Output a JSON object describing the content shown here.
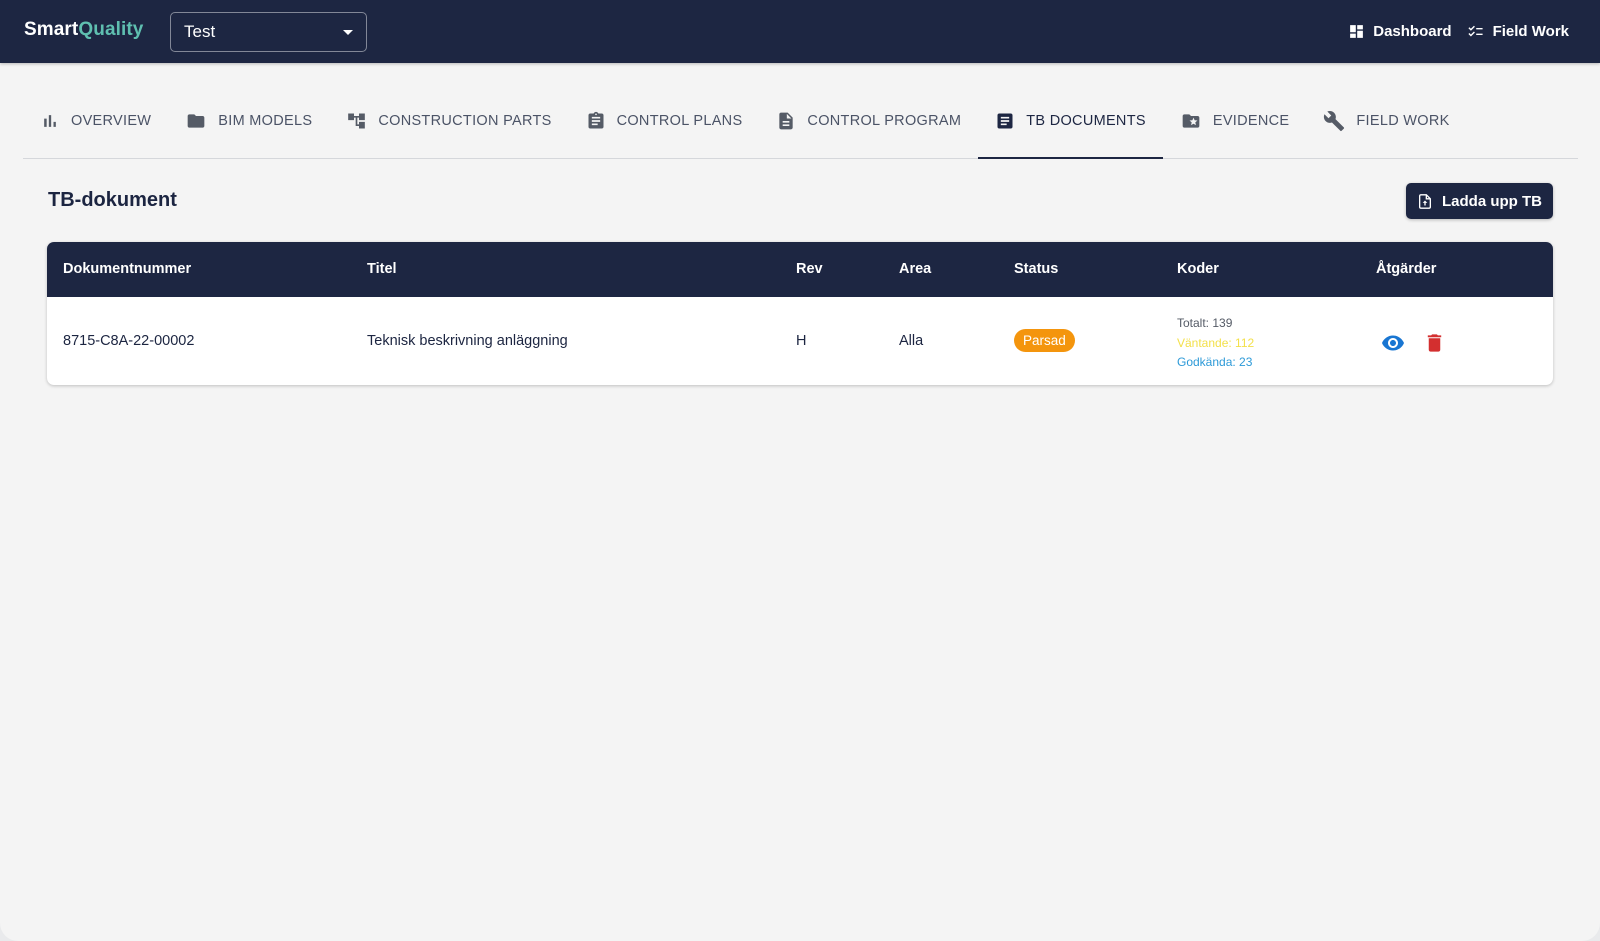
{
  "brand": {
    "part1": "Smart",
    "part2": "Quality",
    "accent_color": "#5fbfb0"
  },
  "project_select": {
    "value": "Test",
    "icon": "caret-down-icon"
  },
  "topnav": [
    {
      "label": "Dashboard",
      "icon": "dashboard-icon"
    },
    {
      "label": "Field Work",
      "icon": "checklist-icon"
    }
  ],
  "tabs": [
    {
      "label": "OVERVIEW",
      "icon": "bar-chart-icon"
    },
    {
      "label": "BIM MODELS",
      "icon": "folder-icon"
    },
    {
      "label": "CONSTRUCTION PARTS",
      "icon": "hierarchy-icon"
    },
    {
      "label": "CONTROL PLANS",
      "icon": "clipboard-icon"
    },
    {
      "label": "CONTROL PROGRAM",
      "icon": "document-icon"
    },
    {
      "label": "TB DOCUMENTS",
      "icon": "article-icon",
      "active": true
    },
    {
      "label": "EVIDENCE",
      "icon": "star-folder-icon"
    },
    {
      "label": "FIELD WORK",
      "icon": "wrench-icon"
    }
  ],
  "section": {
    "title": "TB-dokument",
    "upload_label": "Ladda upp TB",
    "upload_icon": "file-upload-icon"
  },
  "table": {
    "columns": [
      "Dokumentnummer",
      "Titel",
      "Rev",
      "Area",
      "Status",
      "Koder",
      "Åtgärder"
    ],
    "rows": [
      {
        "doc_number": "8715-C8A-22-00002",
        "title": "Teknisk beskrivning anläggning",
        "rev": "H",
        "area": "Alla",
        "status": "Parsad",
        "codes": {
          "total": "Totalt: 139",
          "pending": "Väntande: 112",
          "approved": "Godkända: 23"
        },
        "actions": [
          "eye-icon",
          "trash-icon"
        ]
      }
    ]
  },
  "colors": {
    "primary": "#1d2642",
    "status_parsed": "#f4950d",
    "pending": "#f3e04a",
    "approved": "#2d9ad8",
    "view": "#1976d2",
    "delete": "#d32f2f"
  }
}
